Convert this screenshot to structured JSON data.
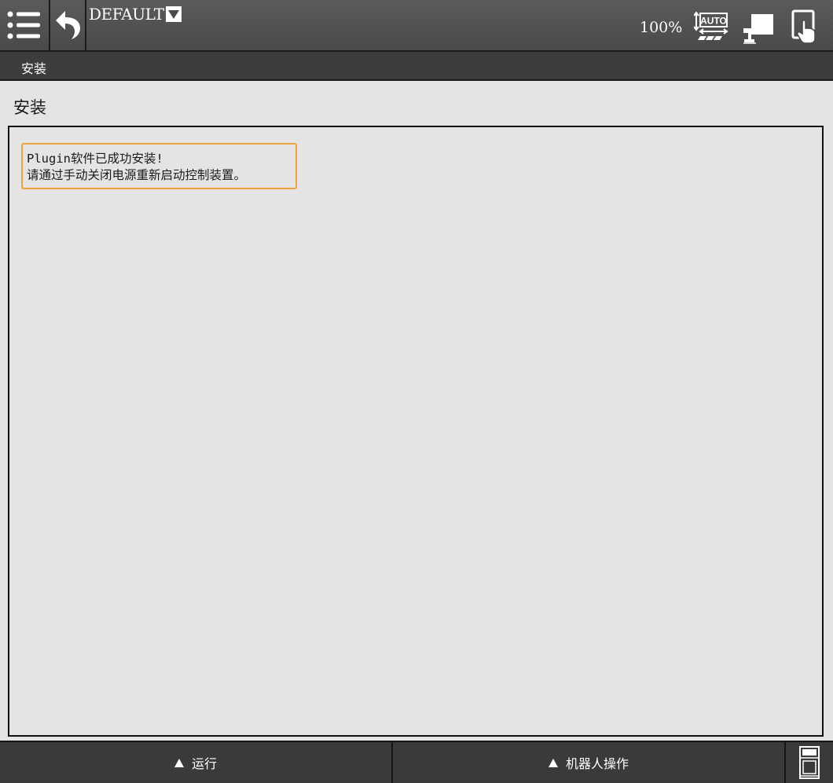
{
  "header": {
    "menu_icon": "menu-icon",
    "back_icon": "back-arrow-icon",
    "program_name": "DEFAULT",
    "speed": "100%",
    "mode_icon": "auto-mode-icon",
    "mode_label": "AUTO",
    "remote_icon": "remote-control-icon",
    "teach_icon": "teach-pendant-icon"
  },
  "breadcrumb": {
    "label": "安装"
  },
  "page": {
    "title": "安装",
    "message_line1": "Plugin软件已成功安装!",
    "message_line2": "请通过手动关闭电源重新启动控制装置。"
  },
  "bottom": {
    "run_label": "运行",
    "robot_label": "机器人操作",
    "side_icon": "panel-icon"
  },
  "colors": {
    "header_bg": "#4f4f4f",
    "breadcrumb_bg": "#3c3c3c",
    "content_bg": "#e4e4e4",
    "message_border": "#f0a03c",
    "bottom_bg": "#3a3a3a"
  }
}
